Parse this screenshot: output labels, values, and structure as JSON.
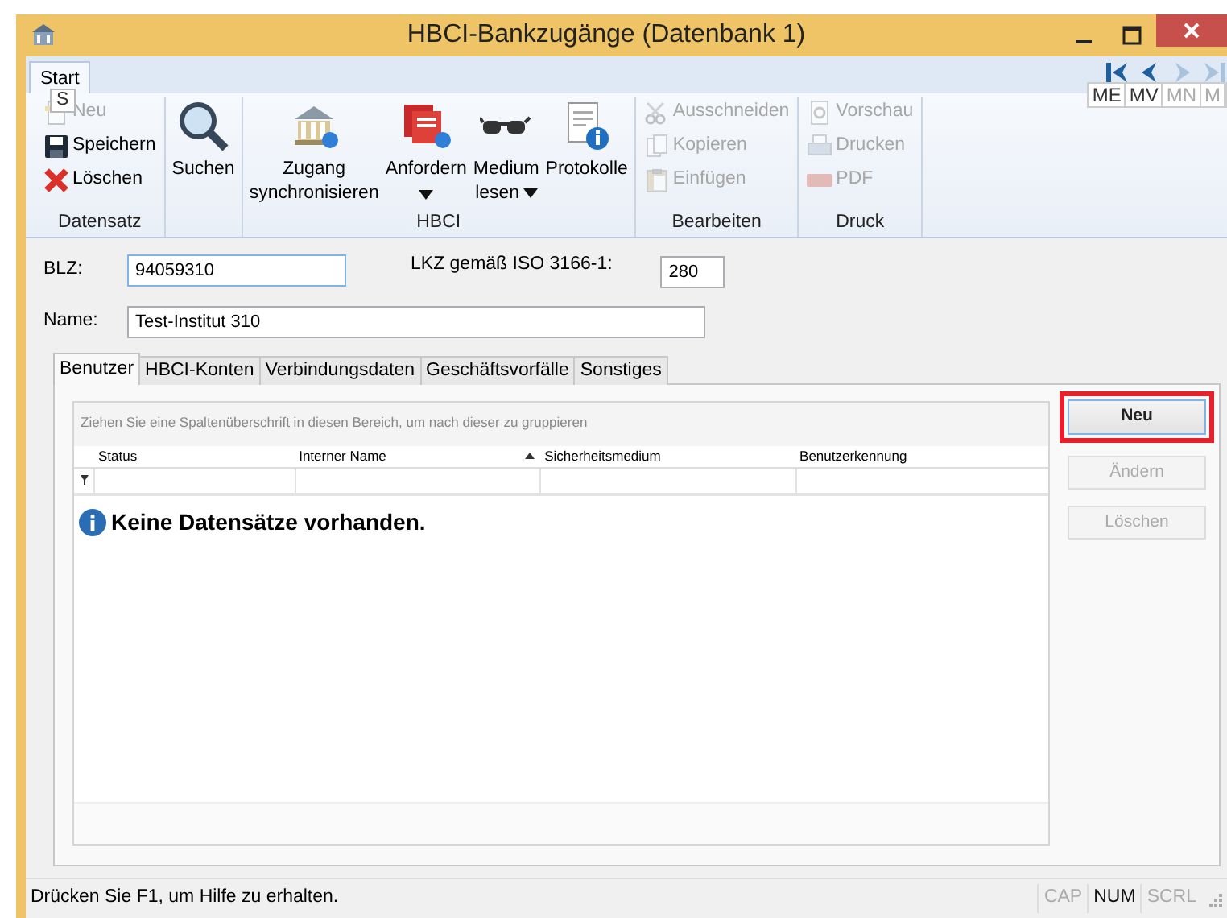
{
  "window": {
    "title": "HBCI-Bankzugänge (Datenbank 1)"
  },
  "ribbon": {
    "tabs": [
      {
        "label": "Start",
        "selected": true
      }
    ],
    "keytip": "S",
    "groups": [
      {
        "label": "Datensatz",
        "items": [
          {
            "label": "Neu",
            "kind": "small",
            "disabled": true
          },
          {
            "label": "Speichern",
            "kind": "small",
            "disabled": false
          },
          {
            "label": "Löschen",
            "kind": "small",
            "disabled": false
          }
        ]
      },
      {
        "items": [
          {
            "label": "Suchen",
            "kind": "large",
            "disabled": false
          }
        ]
      },
      {
        "label": "HBCI",
        "items": [
          {
            "label": "Zugang synchronisieren",
            "kind": "large",
            "disabled": false,
            "dropdown": false
          },
          {
            "label": "Anfordern",
            "kind": "large",
            "disabled": false,
            "dropdown": true
          },
          {
            "label": "Medium lesen",
            "kind": "large",
            "disabled": false,
            "dropdown": true
          },
          {
            "label": "Protokolle",
            "kind": "large",
            "disabled": false,
            "dropdown": false
          }
        ]
      },
      {
        "label": "Bearbeiten",
        "items": [
          {
            "label": "Ausschneiden",
            "kind": "small",
            "disabled": true
          },
          {
            "label": "Kopieren",
            "kind": "small",
            "disabled": true
          },
          {
            "label": "Einfügen",
            "kind": "small",
            "disabled": true
          }
        ]
      },
      {
        "label": "Druck",
        "items": [
          {
            "label": "Vorschau",
            "kind": "small",
            "disabled": true
          },
          {
            "label": "Drucken",
            "kind": "small",
            "disabled": true
          },
          {
            "label": "PDF",
            "kind": "small",
            "disabled": true
          }
        ]
      }
    ],
    "nav_buttons": [
      {
        "keytip": "ME",
        "disabled": false
      },
      {
        "keytip": "MV",
        "disabled": false
      },
      {
        "keytip": "MN",
        "disabled": true
      },
      {
        "keytip": "M",
        "disabled": true
      }
    ]
  },
  "form": {
    "blz": {
      "label": "BLZ:",
      "value": "94059310"
    },
    "lkz": {
      "label": "LKZ gemäß ISO 3166-1:",
      "value": "280"
    },
    "name": {
      "label": "Name:",
      "value": "Test-Institut 310"
    }
  },
  "tabs": [
    {
      "label": "Benutzer",
      "selected": true
    },
    {
      "label": "HBCI-Konten",
      "selected": false
    },
    {
      "label": "Verbindungsdaten",
      "selected": false
    },
    {
      "label": "Geschäftsvorfälle",
      "selected": false
    },
    {
      "label": "Sonstiges",
      "selected": false
    }
  ],
  "grid": {
    "group_hint": "Ziehen Sie eine Spaltenüberschrift in diesen Bereich, um nach dieser zu gruppieren",
    "columns": [
      {
        "label": "Status",
        "sorted": false
      },
      {
        "label": "Interner Name",
        "sorted": true
      },
      {
        "label": "Sicherheitsmedium",
        "sorted": false
      },
      {
        "label": "Benutzerkennung",
        "sorted": false
      }
    ],
    "empty_message": "Keine Datensätze vorhanden."
  },
  "side_buttons": [
    {
      "label": "Neu",
      "disabled": false,
      "highlighted": true
    },
    {
      "label": "Ändern",
      "disabled": true,
      "highlighted": false
    },
    {
      "label": "Löschen",
      "disabled": true,
      "highlighted": false
    }
  ],
  "status_bar": {
    "text": "Drücken Sie F1, um Hilfe zu erhalten.",
    "indicators": [
      {
        "label": "CAP",
        "on": false
      },
      {
        "label": "NUM",
        "on": true
      },
      {
        "label": "SCRL",
        "on": false
      }
    ]
  }
}
